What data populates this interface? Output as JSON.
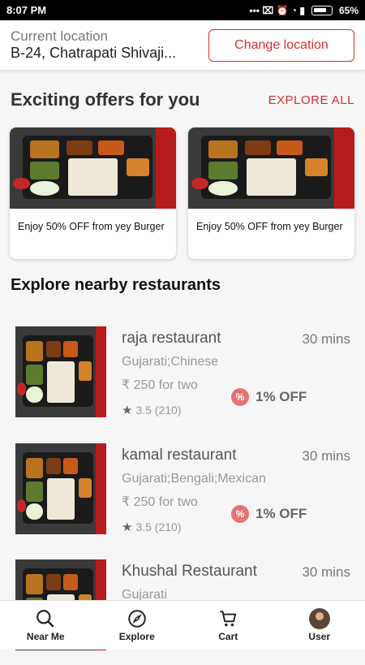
{
  "status": {
    "time": "8:07 PM",
    "icons": "••• ⌧ ⏰ ◔ ▮",
    "battery": "65%"
  },
  "location": {
    "label": "Current location",
    "address": "B-24, Chatrapati Shivaji...",
    "change_label": "Change location"
  },
  "offers": {
    "title": "Exciting offers for you",
    "explore_all": "EXPLORE ALL",
    "cards": [
      {
        "text": "Enjoy 50% OFF from yey Burger"
      },
      {
        "text": "Enjoy 50% OFF from yey Burger"
      }
    ]
  },
  "nearby": {
    "title": "Explore nearby restaurants",
    "restaurants": [
      {
        "name": "raja restaurant",
        "time": "30 mins",
        "cuisine": "Gujarati;Chinese",
        "price": "₹ 250 for two",
        "rating": "3.5 (210)",
        "offer": "1% OFF"
      },
      {
        "name": "kamal restaurant",
        "time": "30 mins",
        "cuisine": "Gujarati;Bengali;Mexican",
        "price": "₹ 250 for two",
        "rating": "3.5 (210)",
        "offer": "1% OFF"
      },
      {
        "name": "Khushal Restaurant",
        "time": "30 mins",
        "cuisine": "Gujarati",
        "price": "",
        "rating": "",
        "offer": ""
      }
    ]
  },
  "nav": {
    "near_me": "Near Me",
    "explore": "Explore",
    "cart": "Cart",
    "user": "User"
  },
  "colors": {
    "accent": "#d32f2f",
    "badge": "#e57373"
  },
  "icons": {
    "near_me": "search-icon",
    "explore": "compass-icon",
    "cart": "cart-icon",
    "user": "avatar",
    "rating": "star-icon",
    "offer": "percent-badge-icon"
  }
}
